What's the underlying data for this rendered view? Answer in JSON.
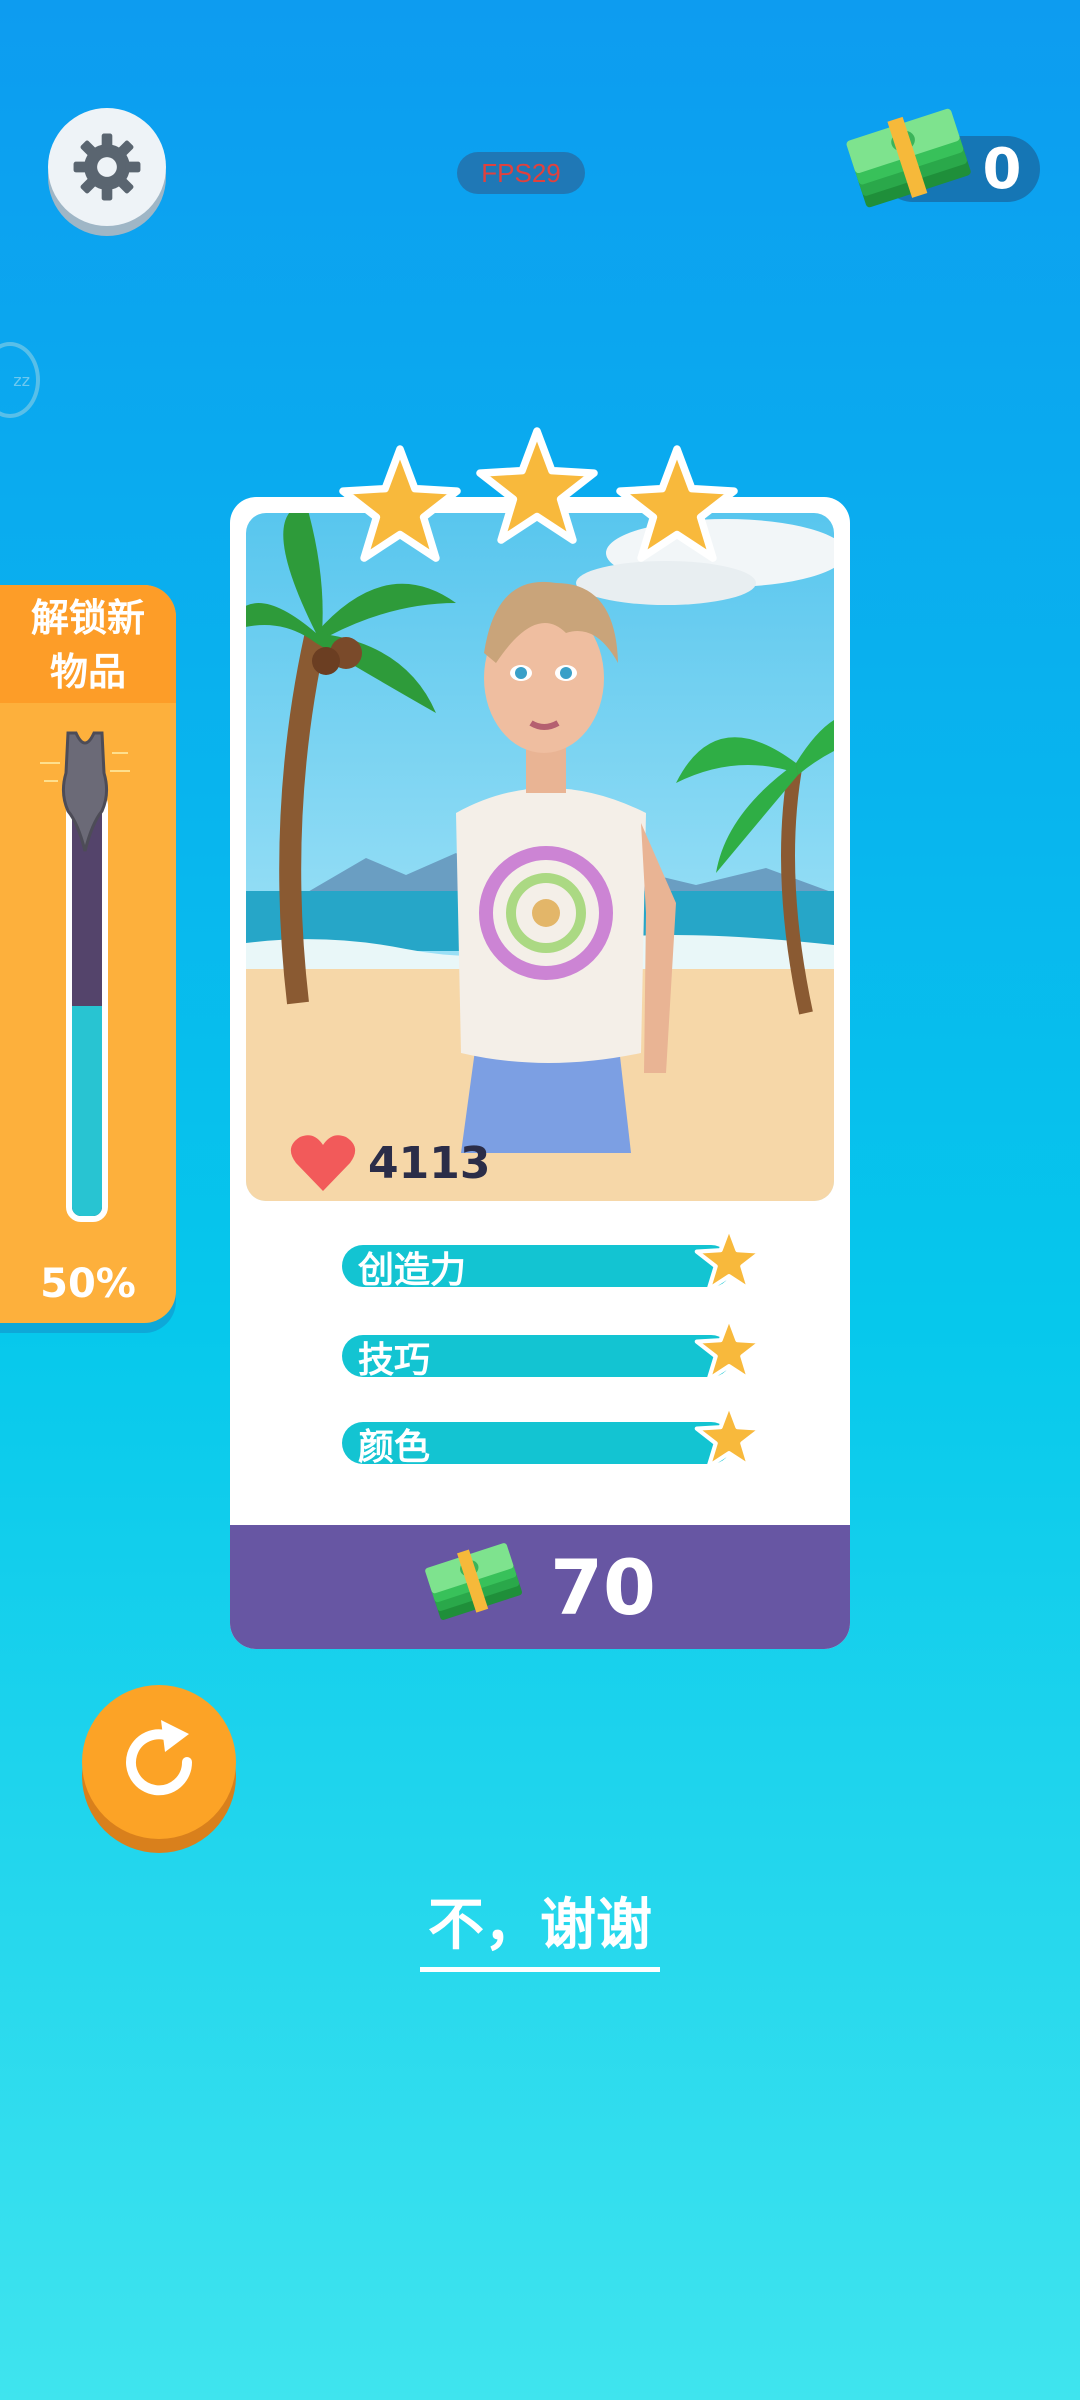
{
  "hud": {
    "fps_label": "FPS29",
    "cash_amount": "0"
  },
  "unlock_panel": {
    "title": "解锁新\n物品",
    "progress_percent": 50,
    "progress_label": "50%",
    "item_icon": "swimsuit-icon"
  },
  "card": {
    "stars_earned": 3,
    "likes_count": "4113",
    "stats": [
      {
        "label": "创造力",
        "stars": 1
      },
      {
        "label": "技巧",
        "stars": 1
      },
      {
        "label": "颜色",
        "stars": 1
      }
    ],
    "reward_amount": "70"
  },
  "actions": {
    "no_thanks_label": "不，谢谢"
  },
  "colors": {
    "accent_orange": "#fdb03c",
    "stat_bar": "#13c4d2",
    "reward_purple": "#6756a3",
    "heart_red": "#f25a5a"
  }
}
